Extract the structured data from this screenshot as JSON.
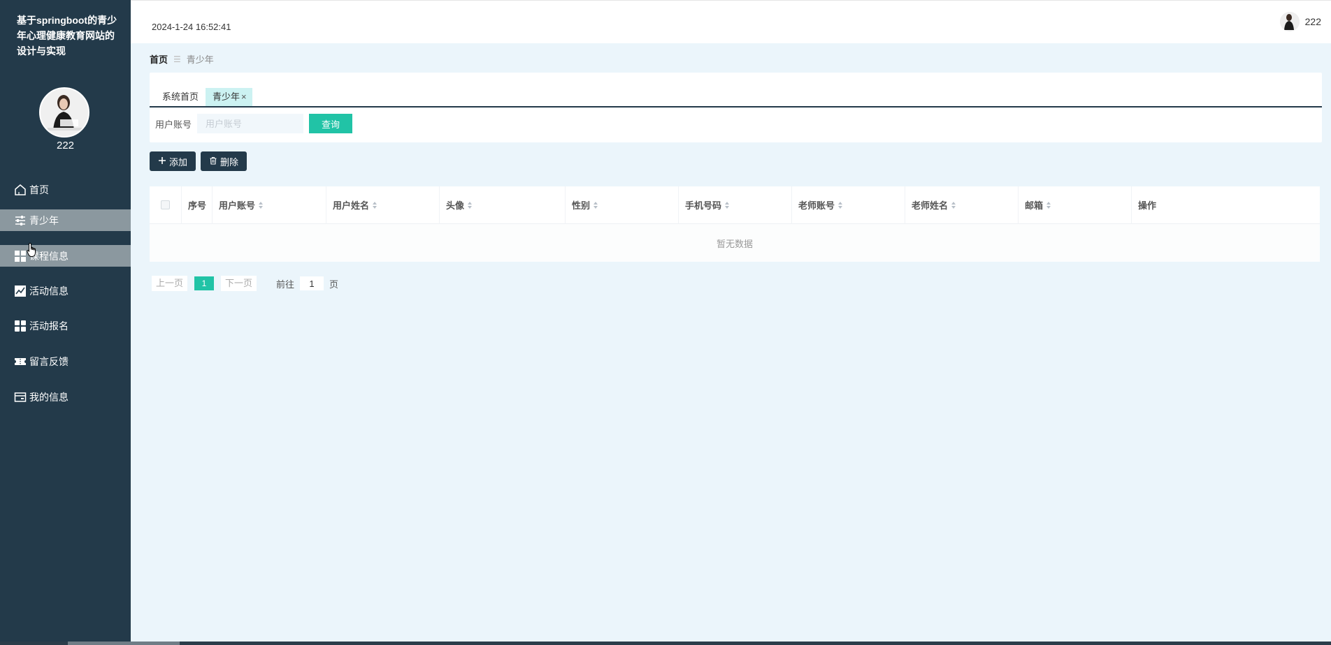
{
  "app": {
    "title": "基于springboot的青少年心理健康教育网站的设计与实现"
  },
  "sidebar": {
    "username": "222",
    "items": [
      {
        "label": "首页",
        "icon": "home-icon"
      },
      {
        "label": "青少年",
        "icon": "sliders-icon"
      },
      {
        "label": "课程信息",
        "icon": "grid-icon"
      },
      {
        "label": "活动信息",
        "icon": "chart-icon"
      },
      {
        "label": "活动报名",
        "icon": "apps-icon"
      },
      {
        "label": "留言反馈",
        "icon": "ticket-icon"
      },
      {
        "label": "我的信息",
        "icon": "wallet-icon"
      }
    ],
    "active_index": 1
  },
  "header": {
    "datetime": "2024-1-24 16:52:41",
    "username": "222"
  },
  "breadcrumb": {
    "home": "首页",
    "separator": "☰",
    "current": "青少年"
  },
  "tabs": [
    {
      "label": "系统首页"
    },
    {
      "label": "青少年",
      "close": "×"
    }
  ],
  "search": {
    "label": "用户账号",
    "placeholder": "用户账号",
    "value": "",
    "button": "查询"
  },
  "actions": {
    "add_label": "添加",
    "delete_label": "删除"
  },
  "table": {
    "columns": [
      "序号",
      "用户账号",
      "用户姓名",
      "头像",
      "性别",
      "手机号码",
      "老师账号",
      "老师姓名",
      "邮箱",
      "操作"
    ],
    "sortable": [
      false,
      true,
      true,
      true,
      true,
      true,
      true,
      true,
      true,
      false
    ],
    "rows": [],
    "empty_text": "暂无数据"
  },
  "pagination": {
    "prev": "上一页",
    "next": "下一页",
    "current_page": "1",
    "goto_label": "前往",
    "goto_value": "1",
    "page_unit": "页"
  },
  "colors": {
    "sidebar_bg": "#233a4a",
    "accent": "#21c3a6",
    "page_bg": "#ebf5fb"
  }
}
